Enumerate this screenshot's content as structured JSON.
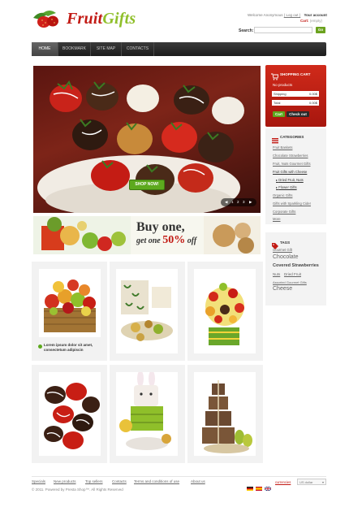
{
  "header": {
    "logo_part1": "Fruit",
    "logo_part2": "Gifts",
    "welcome_text": "Welcome Anonymous",
    "login_link": "( Log out )",
    "your_account": "Your account",
    "cart_label": "Cart:",
    "cart_status": "(empty)",
    "search_label": "Search:",
    "search_button": "Go"
  },
  "nav": {
    "items": [
      {
        "label": "HOME"
      },
      {
        "label": "BOOKMARK"
      },
      {
        "label": "SITE MAP"
      },
      {
        "label": "CONTACTS"
      }
    ]
  },
  "hero": {
    "button_label": "SHOP NOW!",
    "pager": [
      "1",
      "2",
      "3"
    ]
  },
  "banner": {
    "line1": "Buy one,",
    "line2": "get one",
    "percent": "50%",
    "suffix": "off"
  },
  "cart": {
    "title": "SHOPPING CART",
    "no_products": "No products",
    "shipping_label": "Shipping",
    "shipping_value": "0.00$",
    "total_label": "Total",
    "total_value": "0.00$",
    "cart_button": "Cart",
    "checkout_button": "Check out"
  },
  "categories": {
    "title": "CATEGORIES",
    "items": [
      "Fruit Baskets",
      "Chocolate Strawberries",
      "Fruit, Nuts Gourmet Gifts",
      "Fruit Gifts with Cheese",
      "Dried Fruit, Nuts",
      "Flower Gifts",
      "Organic Gifts",
      "Gifts with Sparkling Cider",
      "Corporate Gifts",
      "More"
    ]
  },
  "tags": {
    "title": "TAGS",
    "items": [
      "Gourmet Gift",
      "Chocolate",
      "Covered Strawberries",
      "Nuts",
      "Dried Fruit",
      "Assorted Gourmet Gifts",
      "Cheese"
    ]
  },
  "products": {
    "featured_desc_line1": "Lorem ipsum dolor sit amet,",
    "featured_desc_line2": "consectetum adipiscin"
  },
  "footer": {
    "links": [
      "Specials",
      "New products",
      "Top sellers",
      "Contacts",
      "Terms and conditions of use",
      "About us"
    ],
    "copyright": "© 2011. Powered by Presta Shop™. All Rights Reserved",
    "currencies_label": "currencies",
    "currency_value": "US dollar"
  },
  "colors": {
    "brand_red": "#c21a14",
    "brand_green": "#8fbf2a",
    "button_green": "#5da91e",
    "nav_dark": "#2a2a2a"
  }
}
